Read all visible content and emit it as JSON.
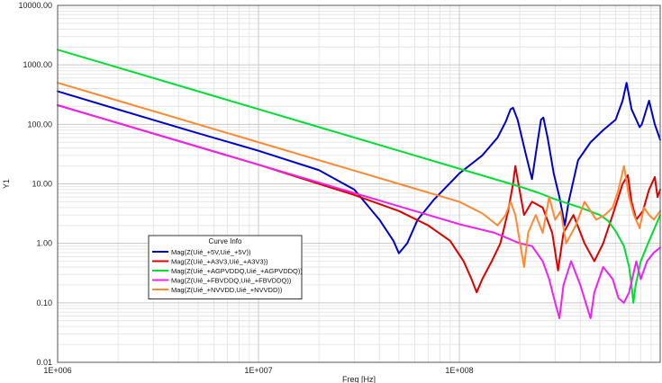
{
  "chart_data": {
    "type": "line",
    "title": "",
    "xlabel": "Freq [Hz]",
    "ylabel": "Y1",
    "xscale": "log",
    "yscale": "log",
    "xlim": [
      1000000,
      1000000000
    ],
    "ylim": [
      0.01,
      10000
    ],
    "grid": true,
    "legend_title": "Curve Info",
    "legend_position": "bottom-left",
    "x_ticks": [
      {
        "value": 1000000,
        "label": "1E+006"
      },
      {
        "value": 10000000,
        "label": "1E+007"
      },
      {
        "value": 100000000,
        "label": "1E+008"
      }
    ],
    "y_ticks": [
      {
        "value": 10000,
        "label": "10000.00"
      },
      {
        "value": 1000,
        "label": "1000.00"
      },
      {
        "value": 100,
        "label": "100.00"
      },
      {
        "value": 10,
        "label": "10.00"
      },
      {
        "value": 1,
        "label": "1.00"
      },
      {
        "value": 0.1,
        "label": "0.10"
      },
      {
        "value": 0.01,
        "label": "0.01"
      }
    ],
    "series": [
      {
        "name": "Mag(Z(Uié_+5V,Uié_+5V))",
        "color": "#0000cc",
        "points": [
          [
            1000000,
            360
          ],
          [
            2000000,
            178
          ],
          [
            5000000,
            71
          ],
          [
            10000000,
            36
          ],
          [
            20000000,
            17
          ],
          [
            30000000,
            8
          ],
          [
            40000000,
            2.5
          ],
          [
            47000000,
            1.1
          ],
          [
            50000000,
            0.68
          ],
          [
            55000000,
            1.0
          ],
          [
            62000000,
            2.5
          ],
          [
            75000000,
            5.5
          ],
          [
            100000000,
            15
          ],
          [
            130000000,
            30
          ],
          [
            155000000,
            60
          ],
          [
            170000000,
            110
          ],
          [
            180000000,
            180
          ],
          [
            185000000,
            190
          ],
          [
            195000000,
            120
          ],
          [
            215000000,
            30
          ],
          [
            230000000,
            12
          ],
          [
            245000000,
            50
          ],
          [
            255000000,
            120
          ],
          [
            262000000,
            130
          ],
          [
            275000000,
            60
          ],
          [
            295000000,
            15
          ],
          [
            315000000,
            6
          ],
          [
            335000000,
            2.0
          ],
          [
            350000000,
            5
          ],
          [
            390000000,
            25
          ],
          [
            450000000,
            50
          ],
          [
            520000000,
            80
          ],
          [
            600000000,
            120
          ],
          [
            650000000,
            250
          ],
          [
            680000000,
            500
          ],
          [
            720000000,
            180
          ],
          [
            790000000,
            90
          ],
          [
            810000000,
            100
          ],
          [
            880000000,
            250
          ],
          [
            940000000,
            100
          ],
          [
            1000000000,
            55
          ]
        ]
      },
      {
        "name": "Mag(Z(Uié_+A3V3,Uié_+A3V3))",
        "color": "#dd0000",
        "points": [
          [
            1000000,
            210
          ],
          [
            2000000,
            105
          ],
          [
            5000000,
            42
          ],
          [
            10000000,
            21
          ],
          [
            20000000,
            10
          ],
          [
            30000000,
            6.5
          ],
          [
            50000000,
            3.5
          ],
          [
            70000000,
            2.0
          ],
          [
            90000000,
            1.1
          ],
          [
            105000000,
            0.5
          ],
          [
            115000000,
            0.25
          ],
          [
            122000000,
            0.15
          ],
          [
            130000000,
            0.25
          ],
          [
            145000000,
            0.5
          ],
          [
            160000000,
            1.0
          ],
          [
            175000000,
            3.5
          ],
          [
            185000000,
            10
          ],
          [
            190000000,
            20
          ],
          [
            195000000,
            12
          ],
          [
            210000000,
            3
          ],
          [
            230000000,
            5
          ],
          [
            260000000,
            4
          ],
          [
            290000000,
            1.5
          ],
          [
            310000000,
            0.35
          ],
          [
            330000000,
            1.5
          ],
          [
            370000000,
            3
          ],
          [
            420000000,
            1.0
          ],
          [
            470000000,
            0.5
          ],
          [
            520000000,
            1.0
          ],
          [
            580000000,
            3
          ],
          [
            650000000,
            10
          ],
          [
            690000000,
            14
          ],
          [
            720000000,
            5
          ],
          [
            760000000,
            2.5
          ],
          [
            820000000,
            3.5
          ],
          [
            880000000,
            8
          ],
          [
            940000000,
            13
          ],
          [
            970000000,
            6
          ],
          [
            1000000000,
            8
          ]
        ]
      },
      {
        "name": "Mag(Z(Uié_+AGPVDDQ,Uié_+AGPVDDQ))",
        "color": "#00dd33",
        "points": [
          [
            1000000,
            1800
          ],
          [
            2000000,
            900
          ],
          [
            5000000,
            360
          ],
          [
            10000000,
            180
          ],
          [
            20000000,
            90
          ],
          [
            50000000,
            36
          ],
          [
            100000000,
            18
          ],
          [
            150000000,
            12
          ],
          [
            200000000,
            9
          ],
          [
            250000000,
            7
          ],
          [
            300000000,
            5.5
          ],
          [
            400000000,
            4
          ],
          [
            500000000,
            3
          ],
          [
            550000000,
            2.4
          ],
          [
            600000000,
            1.6
          ],
          [
            660000000,
            0.9
          ],
          [
            700000000,
            0.4
          ],
          [
            720000000,
            0.2
          ],
          [
            735000000,
            0.1
          ],
          [
            755000000,
            0.2
          ],
          [
            800000000,
            0.5
          ],
          [
            870000000,
            1.0
          ],
          [
            950000000,
            2.0
          ],
          [
            1000000000,
            3
          ]
        ]
      },
      {
        "name": "Mag(Z(Uié_+FBVDDQ,Uié_+FBVDDQ))",
        "color": "#ee22ee",
        "points": [
          [
            1000000,
            210
          ],
          [
            2000000,
            105
          ],
          [
            5000000,
            42
          ],
          [
            10000000,
            21
          ],
          [
            20000000,
            10.5
          ],
          [
            50000000,
            4.2
          ],
          [
            100000000,
            2.1
          ],
          [
            150000000,
            1.5
          ],
          [
            200000000,
            1.0
          ],
          [
            230000000,
            0.9
          ],
          [
            260000000,
            0.5
          ],
          [
            280000000,
            0.25
          ],
          [
            300000000,
            0.1
          ],
          [
            315000000,
            0.055
          ],
          [
            330000000,
            0.2
          ],
          [
            360000000,
            0.5
          ],
          [
            400000000,
            0.2
          ],
          [
            430000000,
            0.09
          ],
          [
            450000000,
            0.055
          ],
          [
            470000000,
            0.15
          ],
          [
            520000000,
            0.4
          ],
          [
            580000000,
            0.25
          ],
          [
            620000000,
            0.12
          ],
          [
            660000000,
            0.1
          ],
          [
            700000000,
            0.15
          ],
          [
            760000000,
            0.5
          ],
          [
            800000000,
            0.25
          ],
          [
            860000000,
            0.5
          ],
          [
            930000000,
            0.7
          ],
          [
            1000000000,
            0.85
          ]
        ]
      },
      {
        "name": "Mag(Z(Uié_+NVVDD,Uié_+NVVDD))",
        "color": "#ff8833",
        "points": [
          [
            1000000,
            500
          ],
          [
            2000000,
            250
          ],
          [
            5000000,
            100
          ],
          [
            10000000,
            50
          ],
          [
            20000000,
            25
          ],
          [
            50000000,
            10
          ],
          [
            100000000,
            5
          ],
          [
            130000000,
            3.2
          ],
          [
            155000000,
            2.0
          ],
          [
            170000000,
            3.0
          ],
          [
            180000000,
            5
          ],
          [
            190000000,
            3
          ],
          [
            210000000,
            0.4
          ],
          [
            220000000,
            1.5
          ],
          [
            240000000,
            3
          ],
          [
            260000000,
            1.5
          ],
          [
            280000000,
            6
          ],
          [
            300000000,
            2.5
          ],
          [
            320000000,
            3.5
          ],
          [
            340000000,
            1.0
          ],
          [
            380000000,
            2
          ],
          [
            420000000,
            5
          ],
          [
            480000000,
            2.5
          ],
          [
            530000000,
            3
          ],
          [
            580000000,
            4
          ],
          [
            620000000,
            8
          ],
          [
            660000000,
            20
          ],
          [
            700000000,
            6
          ],
          [
            740000000,
            3
          ],
          [
            790000000,
            1.8
          ],
          [
            830000000,
            4
          ],
          [
            880000000,
            3
          ],
          [
            930000000,
            2.5
          ],
          [
            1000000000,
            3.5
          ]
        ]
      }
    ]
  }
}
